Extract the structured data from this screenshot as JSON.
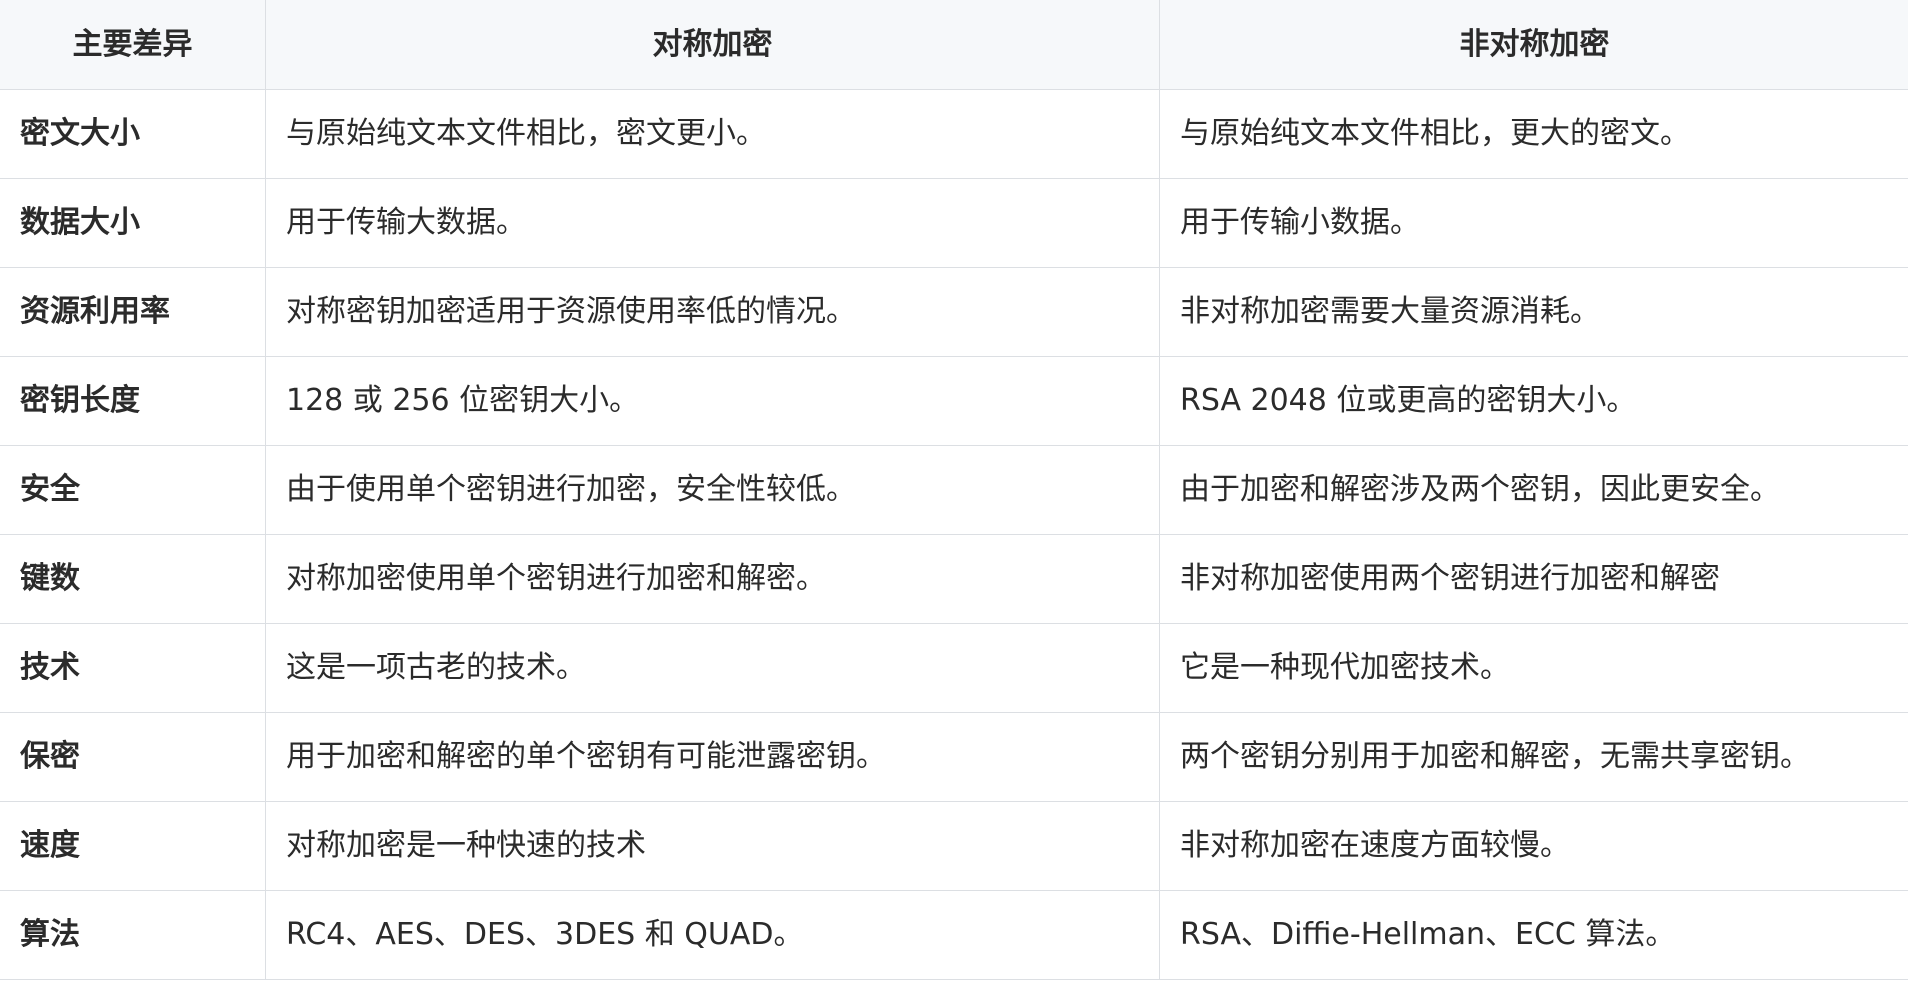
{
  "table": {
    "headers": [
      "主要差异",
      "对称加密",
      "非对称加密"
    ],
    "rows": [
      {
        "label": "密文大小",
        "symmetric": "与原始纯文本文件相比，密文更小。",
        "asymmetric": "与原始纯文本文件相比，更大的密文。"
      },
      {
        "label": "数据大小",
        "symmetric": "用于传输大数据。",
        "asymmetric": "用于传输小数据。"
      },
      {
        "label": "资源利用率",
        "symmetric": "对称密钥加密适用于资源使用率低的情况。",
        "asymmetric": "非对称加密需要大量资源消耗。"
      },
      {
        "label": "密钥长度",
        "symmetric": "128 或 256 位密钥大小。",
        "asymmetric": "RSA 2048 位或更高的密钥大小。"
      },
      {
        "label": "安全",
        "symmetric": "由于使用单个密钥进行加密，安全性较低。",
        "asymmetric": "由于加密和解密涉及两个密钥，因此更安全。"
      },
      {
        "label": "键数",
        "symmetric": "对称加密使用单个密钥进行加密和解密。",
        "asymmetric": "非对称加密使用两个密钥进行加密和解密"
      },
      {
        "label": "技术",
        "symmetric": "这是一项古老的技术。",
        "asymmetric": "它是一种现代加密技术。"
      },
      {
        "label": "保密",
        "symmetric": "用于加密和解密的单个密钥有可能泄露密钥。",
        "asymmetric": "两个密钥分别用于加密和解密，无需共享密钥。"
      },
      {
        "label": "速度",
        "symmetric": "对称加密是一种快速的技术",
        "asymmetric": "非对称加密在速度方面较慢。"
      },
      {
        "label": "算法",
        "symmetric": "RC4、AES、DES、3DES 和 QUAD。",
        "asymmetric": "RSA、Diffie-Hellman、ECC 算法。"
      }
    ]
  }
}
